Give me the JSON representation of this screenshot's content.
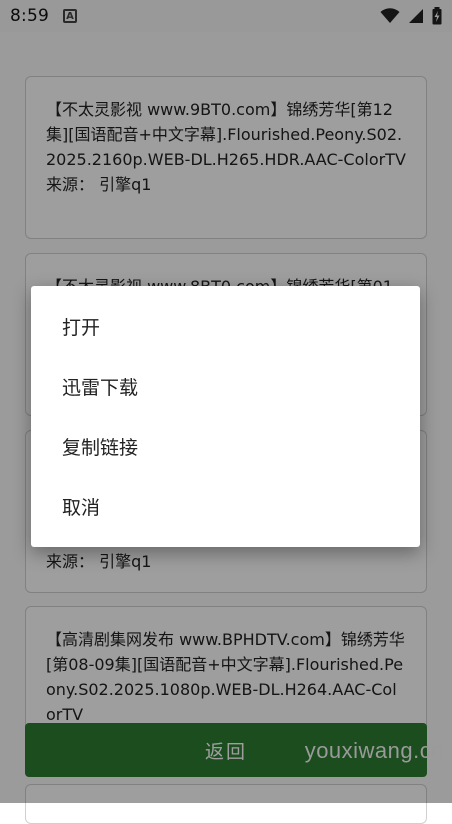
{
  "status_bar": {
    "time": "8:59",
    "notification_icon": "A",
    "icons": [
      "wifi-icon",
      "signal-icon",
      "battery-charging-icon"
    ]
  },
  "results": [
    {
      "title": "【不太灵影视 www.9BT0.com】锦绣芳华[第12集][国语配音+中文字幕].Flourished.Peony.S02.2025.2160p.WEB-DL.H265.HDR.AAC-ColorTV",
      "source": "来源： 引擎q1"
    },
    {
      "title": "【不太灵影视 www.8BT0.com】锦绣芳华[第01",
      "source": ""
    },
    {
      "title": "",
      "source": "来源： 引擎q1"
    },
    {
      "title": "【高清剧集网发布 www.BPHDTV.com】锦绣芳华[第08-09集][国语配音+中文字幕].Flourished.Peony.S02.2025.1080p.WEB-DL.H264.AAC-ColorTV",
      "source": ""
    }
  ],
  "back_button": "返回",
  "dialog": {
    "items": [
      "打开",
      "迅雷下载",
      "复制链接",
      "取消"
    ]
  },
  "watermark": "youxiwang.cn",
  "colors": {
    "accent": "#2e7d32",
    "scrim": "rgba(0,0,0,0.38)"
  }
}
